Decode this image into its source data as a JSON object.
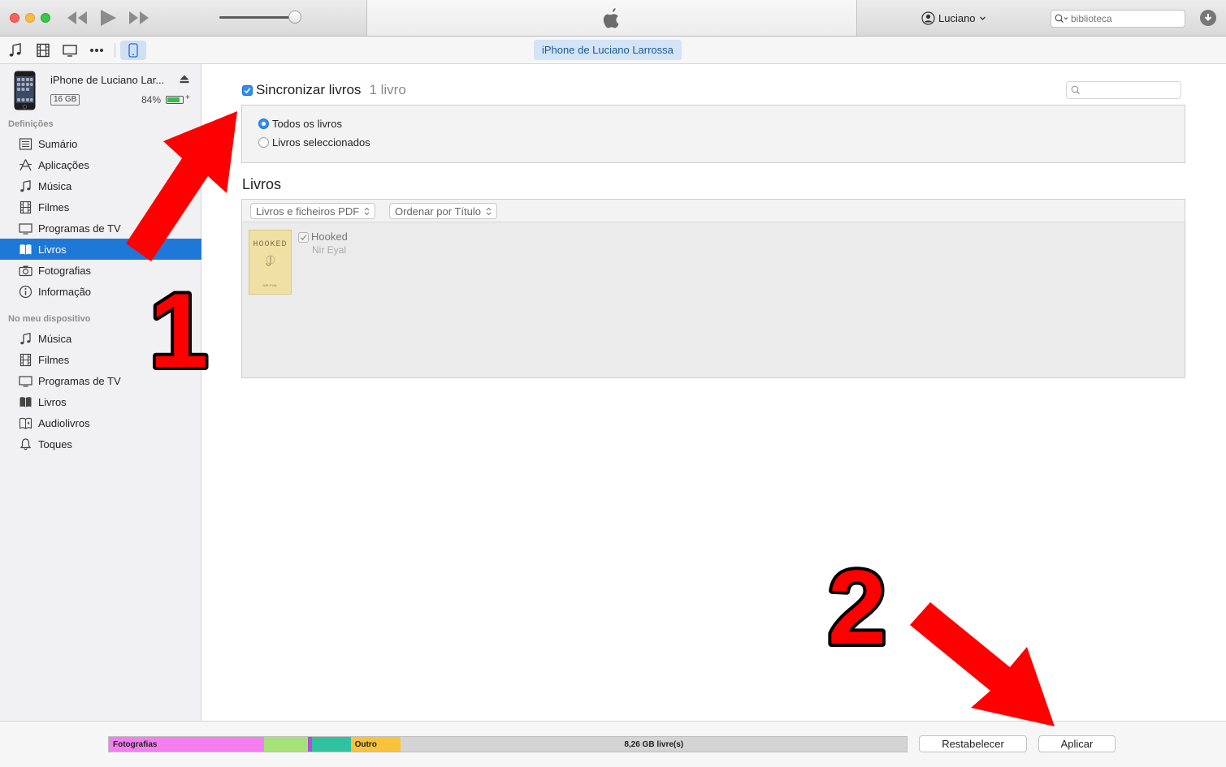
{
  "titlebar": {
    "apple_logo": "apple-logo",
    "account_name": "Luciano",
    "search_placeholder": "biblioteca"
  },
  "toolbar": {
    "device_tab": "iPhone de Luciano Larrossa",
    "icons": [
      "music-note-icon",
      "film-icon",
      "tv-icon",
      "more-icon",
      "iphone-icon"
    ]
  },
  "device": {
    "name": "iPhone de Luciano Lar...",
    "capacity": "16 GB",
    "battery_percent": "84%",
    "battery_level": 0.84
  },
  "sidebar": {
    "settings_label": "Definições",
    "settings_items": [
      {
        "label": "Sumário",
        "icon": "summary-icon"
      },
      {
        "label": "Aplicações",
        "icon": "apps-icon"
      },
      {
        "label": "Música",
        "icon": "music-note-icon"
      },
      {
        "label": "Filmes",
        "icon": "film-icon"
      },
      {
        "label": "Programas de TV",
        "icon": "tv-icon"
      },
      {
        "label": "Livros",
        "icon": "book-icon",
        "active": true
      },
      {
        "label": "Fotografias",
        "icon": "camera-icon"
      },
      {
        "label": "Informação",
        "icon": "info-icon"
      }
    ],
    "device_label": "No meu dispositivo",
    "device_items": [
      {
        "label": "Música",
        "icon": "music-note-icon"
      },
      {
        "label": "Filmes",
        "icon": "film-icon"
      },
      {
        "label": "Programas de TV",
        "icon": "tv-icon"
      },
      {
        "label": "Livros",
        "icon": "book-icon"
      },
      {
        "label": "Audiolivros",
        "icon": "audiobook-icon"
      },
      {
        "label": "Toques",
        "icon": "bell-icon"
      }
    ]
  },
  "main": {
    "sync_label": "Sincronizar livros",
    "sync_count": "1 livro",
    "sync_checked": true,
    "options": [
      {
        "label": "Todos os livros",
        "selected": true
      },
      {
        "label": "Livros seleccionados",
        "selected": false
      }
    ],
    "books_title": "Livros",
    "filter_select": "Livros e ficheiros PDF",
    "sort_select": "Ordenar por Título",
    "books": [
      {
        "title": "Hooked",
        "author": "Nir Eyal",
        "checked": true,
        "cover_title": "HOOKED",
        "cover_author": "NIR EYAL"
      }
    ]
  },
  "footer": {
    "capacity_segments": [
      {
        "label": "Fotografias",
        "color": "#f47ef0",
        "fraction": 0.195
      },
      {
        "label": "",
        "color": "#a6e27a",
        "fraction": 0.055
      },
      {
        "label": "",
        "color": "#b14fd6",
        "fraction": 0.005
      },
      {
        "label": "",
        "color": "#2fc2a0",
        "fraction": 0.048
      },
      {
        "label": "Outro",
        "color": "#f9c23b",
        "fraction": 0.063
      },
      {
        "label": "8,26 GB livre(s)",
        "color": "#d4d4d4",
        "fraction": 0.634,
        "free": true
      }
    ],
    "revert_button": "Restabelecer",
    "apply_button": "Aplicar"
  },
  "annotations": {
    "number_1": "1",
    "number_2": "2",
    "arrow_color": "#ff0000"
  }
}
